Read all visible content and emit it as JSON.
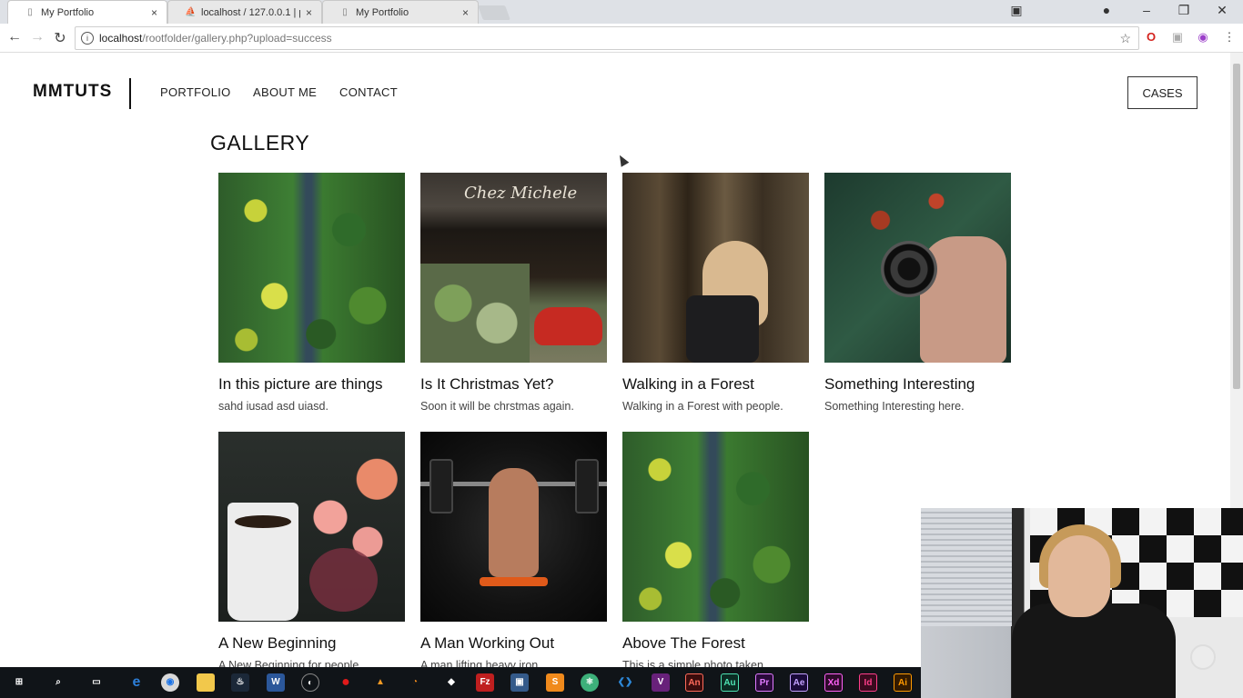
{
  "browser": {
    "tabs": [
      {
        "title": "My Portfolio",
        "favicon": "page-icon",
        "close": "×"
      },
      {
        "title": "localhost / 127.0.0.1 | php",
        "favicon": "phpmyadmin-icon",
        "close": "×"
      },
      {
        "title": "My Portfolio",
        "favicon": "page-icon",
        "close": "×"
      }
    ],
    "url_host": "localhost",
    "url_path": "/rootfolder/gallery.php?upload=success"
  },
  "site": {
    "logo": "MMTUTS",
    "nav": [
      "PORTFOLIO",
      "ABOUT ME",
      "CONTACT"
    ],
    "cases_button": "CASES",
    "gallery_title": "GALLERY"
  },
  "gallery": [
    {
      "title": "In this picture are things",
      "desc": "sahd iusad asd uiasd.",
      "image": "forest-aerial"
    },
    {
      "title": "Is It Christmas Yet?",
      "desc": "Soon it will be chrstmas again.",
      "image": "flower-shop",
      "sign": "Chez Michele"
    },
    {
      "title": "Walking in a Forest",
      "desc": "Walking in a Forest with people.",
      "image": "forest-walk"
    },
    {
      "title": "Something Interesting",
      "desc": "Something Interesting here.",
      "image": "camera-lens"
    },
    {
      "title": "A New Beginning",
      "desc": "A New Beginning for people.",
      "image": "coffee-flowers"
    },
    {
      "title": "A Man Working Out",
      "desc": "A man lifting heavy iron.",
      "image": "weightlifter"
    },
    {
      "title": "Above The Forest",
      "desc": "This is a simple photo taken.",
      "image": "forest-aerial"
    }
  ],
  "taskbar": {
    "apps": [
      "windows-start",
      "search",
      "task-view",
      "edge",
      "chrome",
      "file-explorer",
      "steam",
      "word",
      "obs",
      "record",
      "xampp",
      "blender",
      "unity",
      "filezilla",
      "virtualbox",
      "sublime",
      "atom",
      "vscode",
      "visual-studio",
      "animate",
      "audition",
      "premiere",
      "after-effects",
      "xd",
      "indesign",
      "illustrator"
    ],
    "labels": {
      "animate": "An",
      "audition": "Au",
      "premiere": "Pr",
      "after-effects": "Ae",
      "xd": "Xd",
      "indesign": "Id",
      "illustrator": "Ai",
      "word": "W"
    }
  },
  "colors": {
    "accent": "#111111",
    "tabbar": "#dee1e6",
    "taskbar": "#101418"
  }
}
